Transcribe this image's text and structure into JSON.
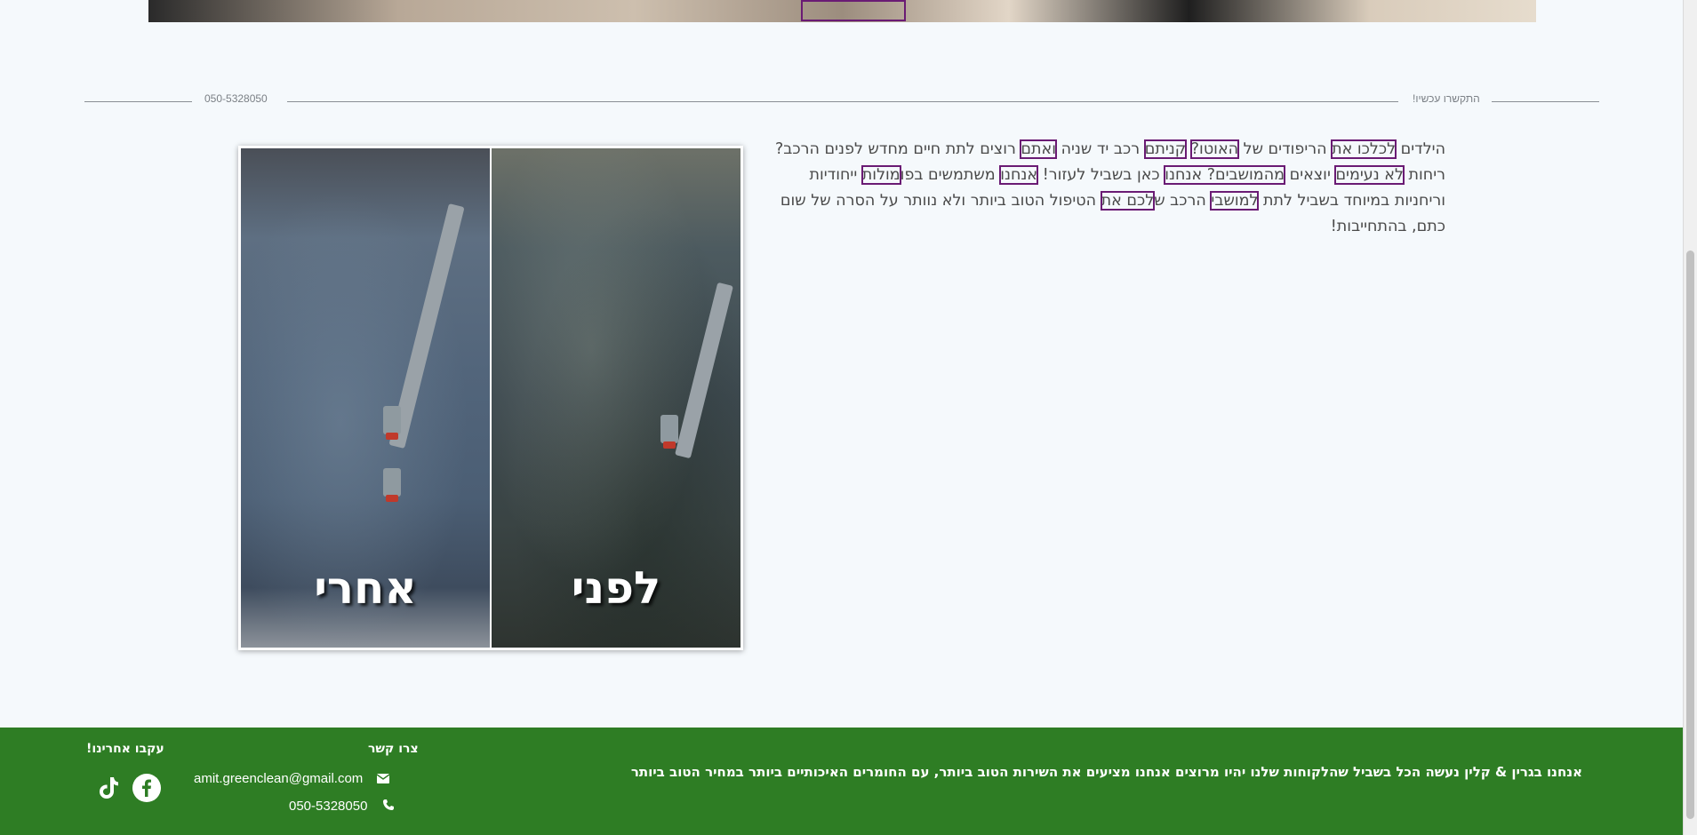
{
  "divider": {
    "left_phone": "050-5328050",
    "right_text": "התקשרו עכשיו!"
  },
  "photo": {
    "after_label": "אחרי",
    "before_label": "לפני"
  },
  "article": {
    "segments": [
      "הילדים ",
      "לכלכו את",
      " הריפודים של ",
      "האוטו?",
      " ",
      "קניתם",
      " רכב יד שניה ",
      "ואתם",
      " רוצים לתת חיים מחדש לפנים הרכב? ריחות ",
      "לא נעימים",
      " יוצאים ",
      "מהמושבים? אנחנו",
      " כאן בשביל לעזור! ",
      "אנחנו",
      " משתמשים בפו",
      "מולות",
      " ייחודיות וריחניות במיוחד בשביל לתת ",
      "למושבי",
      " הרכב ש",
      "לכם את",
      " הטיפול הטוב ביותר ולא נוותר על הסרה של שום כתם, בהתחייבות!"
    ]
  },
  "footer": {
    "tagline": "אנחנו בגרין & קלין נעשה הכל בשביל שהלקוחות שלנו יהיו מרוצים אנחנו מציעים את השירות הטוב ביותר, עם החומרים האיכותיים ביותר במחיר הטוב ביותר",
    "contact_title": "צרו קשר",
    "email": "amit.greenclean@gmail.com",
    "phone": "050-5328050",
    "follow_title": "עקבו אחרינו!",
    "icons": {
      "email": "envelope-icon",
      "phone": "phone-icon",
      "facebook": "facebook-icon",
      "tiktok": "tiktok-icon"
    }
  },
  "colors": {
    "footer_bg": "#2e7d24",
    "highlight": "#6a1b74",
    "page_bg": "#f5f9fc"
  }
}
